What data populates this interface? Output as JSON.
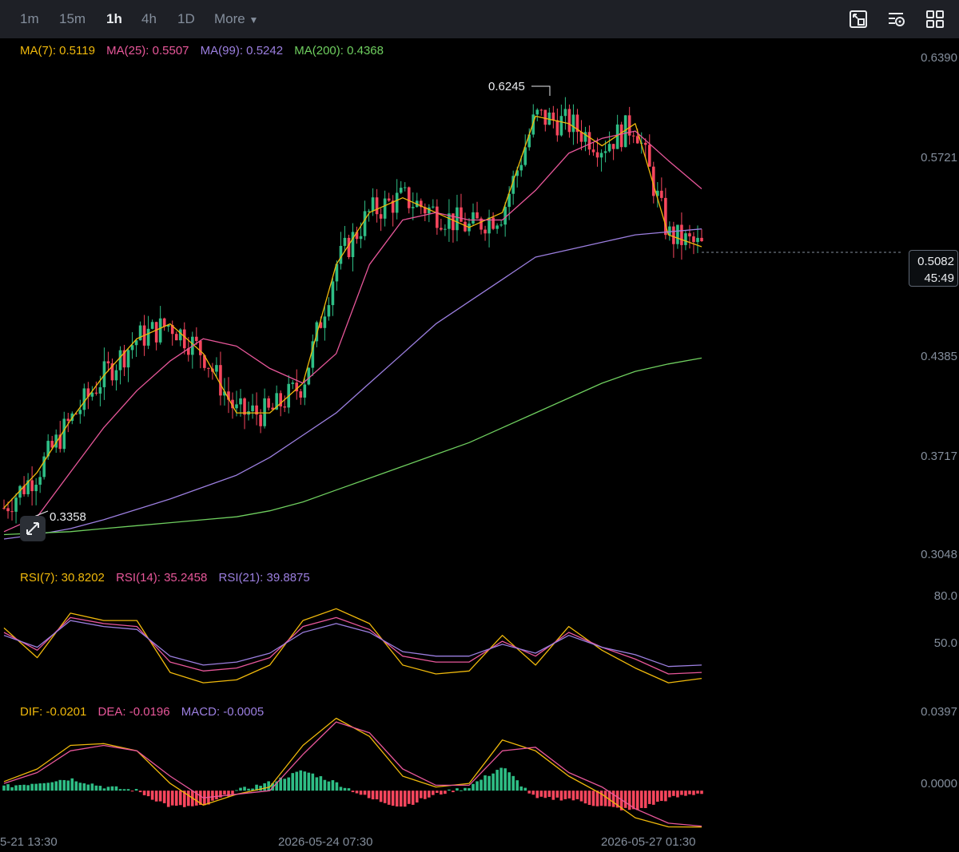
{
  "toolbar": {
    "timeframes": [
      "1m",
      "15m",
      "1h",
      "4h",
      "1D"
    ],
    "active": "1h",
    "more_label": "More",
    "icons": [
      "fullscreen-icon",
      "indicator-settings-icon",
      "layout-grid-icon"
    ]
  },
  "ma_legend": {
    "ma7": "MA(7): 0.5119",
    "ma25": "MA(25): 0.5507",
    "ma99": "MA(99): 0.5242",
    "ma200": "MA(200): 0.4368"
  },
  "rsi_legend": {
    "rsi7": "RSI(7): 30.8202",
    "rsi14": "RSI(14): 35.2458",
    "rsi21": "RSI(21): 39.8875"
  },
  "macd_legend": {
    "dif": "DIF: -0.0201",
    "dea": "DEA: -0.0196",
    "macd": "MACD: -0.0005"
  },
  "price": {
    "current": "0.5082",
    "countdown": "45:49",
    "high_label": "0.6245",
    "low_label": "0.3358"
  },
  "colors": {
    "up": "#2ebd85",
    "down": "#f6465d",
    "ma7": "#f0b90b",
    "ma25": "#e8579a",
    "ma99": "#9c7fe0",
    "ma200": "#6fcf5f"
  },
  "chart_data": [
    {
      "type": "line",
      "title": "",
      "price_axis_ticks": [
        "0.6390",
        "0.5721",
        "0.5082",
        "0.4385",
        "0.3717",
        "0.3048"
      ],
      "ylim": [
        0.3048,
        0.639
      ],
      "x_tick_labels": [
        "5-21 13:30",
        "2026-05-24 07:30",
        "2026-05-27 01:30"
      ],
      "series": [
        {
          "name": "MA(7)",
          "values": [
            0.336,
            0.36,
            0.395,
            0.425,
            0.45,
            0.46,
            0.44,
            0.4,
            0.4,
            0.42,
            0.5,
            0.535,
            0.545,
            0.535,
            0.525,
            0.535,
            0.6,
            0.595,
            0.58,
            0.595,
            0.52,
            0.512
          ]
        },
        {
          "name": "MA(25)",
          "values": [
            0.32,
            0.33,
            0.36,
            0.39,
            0.415,
            0.435,
            0.45,
            0.445,
            0.43,
            0.42,
            0.44,
            0.5,
            0.53,
            0.535,
            0.53,
            0.53,
            0.55,
            0.575,
            0.585,
            0.59,
            0.57,
            0.551
          ]
        },
        {
          "name": "MA(99)",
          "values": [
            0.315,
            0.318,
            0.322,
            0.328,
            0.335,
            0.342,
            0.35,
            0.358,
            0.37,
            0.385,
            0.4,
            0.42,
            0.44,
            0.46,
            0.475,
            0.49,
            0.505,
            0.51,
            0.515,
            0.52,
            0.522,
            0.524
          ]
        },
        {
          "name": "MA(200)",
          "values": [
            0.318,
            0.319,
            0.32,
            0.322,
            0.324,
            0.326,
            0.328,
            0.33,
            0.334,
            0.34,
            0.348,
            0.356,
            0.364,
            0.372,
            0.38,
            0.39,
            0.4,
            0.41,
            0.42,
            0.428,
            0.433,
            0.437
          ]
        }
      ]
    },
    {
      "type": "line",
      "title": "",
      "y_ticks": [
        "80.0",
        "50.0"
      ],
      "ylim": [
        20,
        90
      ],
      "series": [
        {
          "name": "RSI(7)",
          "values": [
            65,
            45,
            75,
            70,
            70,
            35,
            28,
            30,
            40,
            70,
            78,
            68,
            40,
            34,
            36,
            60,
            40,
            66,
            50,
            38,
            28,
            31
          ]
        },
        {
          "name": "RSI(14)",
          "values": [
            62,
            50,
            72,
            68,
            66,
            42,
            36,
            38,
            45,
            66,
            72,
            64,
            46,
            42,
            42,
            56,
            46,
            62,
            52,
            44,
            34,
            35
          ]
        },
        {
          "name": "RSI(21)",
          "values": [
            60,
            52,
            70,
            66,
            64,
            46,
            40,
            42,
            48,
            62,
            68,
            62,
            49,
            46,
            46,
            54,
            48,
            60,
            52,
            47,
            39,
            40
          ]
        }
      ]
    },
    {
      "type": "line",
      "title": "",
      "y_ticks": [
        "0.0397",
        "0.0000"
      ],
      "ylim": [
        -0.022,
        0.042
      ],
      "series": [
        {
          "name": "DIF",
          "values": [
            0.005,
            0.012,
            0.025,
            0.026,
            0.022,
            0.004,
            -0.008,
            -0.002,
            0.002,
            0.025,
            0.04,
            0.03,
            0.008,
            0.002,
            0.004,
            0.028,
            0.022,
            0.008,
            -0.002,
            -0.015,
            -0.02,
            -0.0201
          ]
        },
        {
          "name": "DEA",
          "values": [
            0.004,
            0.01,
            0.022,
            0.025,
            0.022,
            0.008,
            -0.004,
            -0.002,
            0.0,
            0.02,
            0.038,
            0.032,
            0.012,
            0.003,
            0.003,
            0.022,
            0.024,
            0.01,
            0.002,
            -0.01,
            -0.018,
            -0.0196
          ]
        }
      ]
    }
  ]
}
